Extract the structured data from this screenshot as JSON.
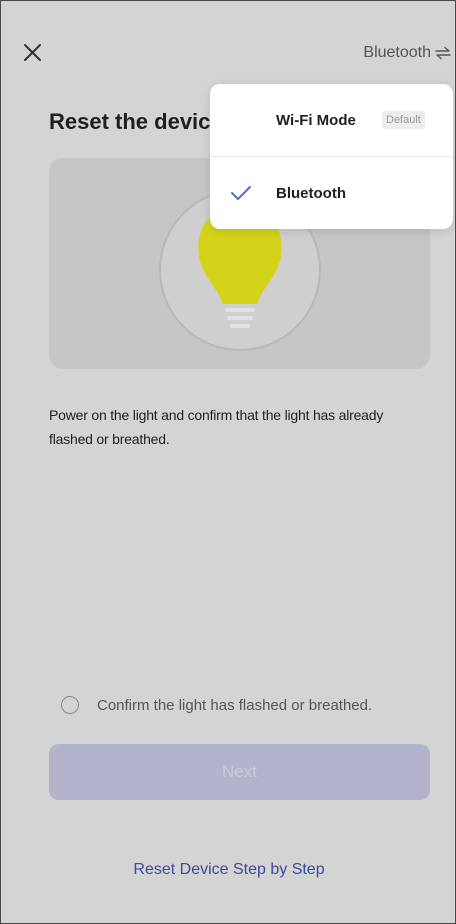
{
  "header": {
    "mode_label": "Bluetooth"
  },
  "page": {
    "title": "Reset the device",
    "description": "Power on the light and confirm that the light has already flashed or breathed."
  },
  "confirm": {
    "label": "Confirm the light has flashed or breathed.",
    "checked": false
  },
  "actions": {
    "next_label": "Next",
    "next_enabled": false,
    "reset_link_label": "Reset Device Step by Step"
  },
  "dropdown": {
    "items": [
      {
        "label": "Wi-Fi Mode",
        "badge": "Default",
        "selected": false
      },
      {
        "label": "Bluetooth",
        "selected": true
      }
    ]
  },
  "icons": {
    "close": "close-icon",
    "swap": "swap-icon",
    "check": "check-icon",
    "bulb": "light-bulb-illustration"
  },
  "colors": {
    "accent": "#3b4a9c",
    "check": "#4a6fd8",
    "button_disabled": "#b3b4cb",
    "background": "#d4d4d4",
    "bulb": "#d3d31a"
  }
}
